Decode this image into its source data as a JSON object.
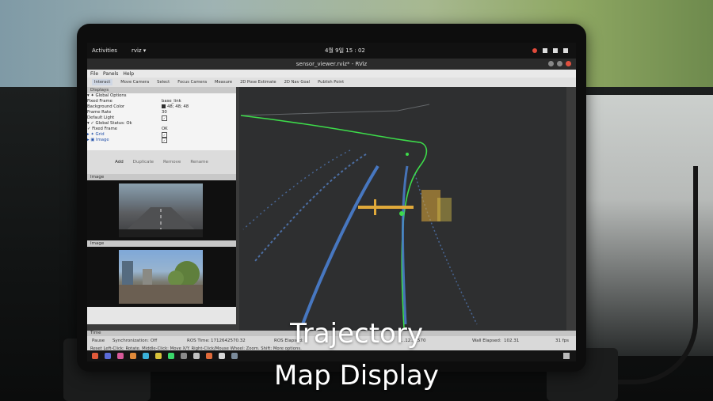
{
  "topbar": {
    "activities": "Activities",
    "app": "rviz ▾",
    "clock": "4월 9일  15 : 02"
  },
  "window": {
    "title": "sensor_viewer.rviz* - RViz"
  },
  "menu": [
    "File",
    "Panels",
    "Help"
  ],
  "toolbar": [
    "Interact",
    "Move Camera",
    "Select",
    "Focus Camera",
    "Measure",
    "2D Pose Estimate",
    "2D Nav Goal",
    "Publish Point"
  ],
  "displays": {
    "header": "Displays",
    "rows": [
      {
        "key": "▾ ✦ Global Options",
        "value": ""
      },
      {
        "key": "      Fixed Frame",
        "value": "base_link"
      },
      {
        "key": "      Background Color",
        "value": "48; 48; 48"
      },
      {
        "key": "      Frame Rate",
        "value": "30"
      },
      {
        "key": "      Default Light",
        "value": "✓"
      },
      {
        "key": "▾ ✓ Global Status: Ok",
        "value": ""
      },
      {
        "key": "      ✓ Fixed Frame",
        "value": "OK"
      },
      {
        "key": "▸ ✦ Grid",
        "value": "✓"
      },
      {
        "key": "▸ ▣ Image",
        "value": "✓"
      }
    ],
    "buttons": [
      "Add",
      "Duplicate",
      "Remove",
      "Rename"
    ]
  },
  "image_panels": [
    "Image",
    "Image"
  ],
  "time": {
    "header": "Time",
    "pause": "Pause",
    "sync_label": "Synchronization:",
    "sync_value": "Off",
    "ros_time_label": "ROS Time:",
    "ros_time_value": "1712642570.32",
    "ros_elapsed_label": "ROS Elapsed:",
    "ros_elapsed_value": "...12...2570",
    "wall_elapsed_label": "Wall Elapsed:",
    "wall_elapsed_value": "102.31",
    "fps": "31 fps",
    "status": "Reset  Left-Click: Rotate. Middle-Click: Move X/Y. Right-Click/Mouse Wheel: Zoom. Shift: More options."
  },
  "caption": {
    "line1": "Trajectory",
    "line2": "Map Display"
  },
  "colors": {
    "trajectory": "#3ddc4a",
    "lidar": "#4a7fd0",
    "points_warm": "#e0a93a"
  }
}
